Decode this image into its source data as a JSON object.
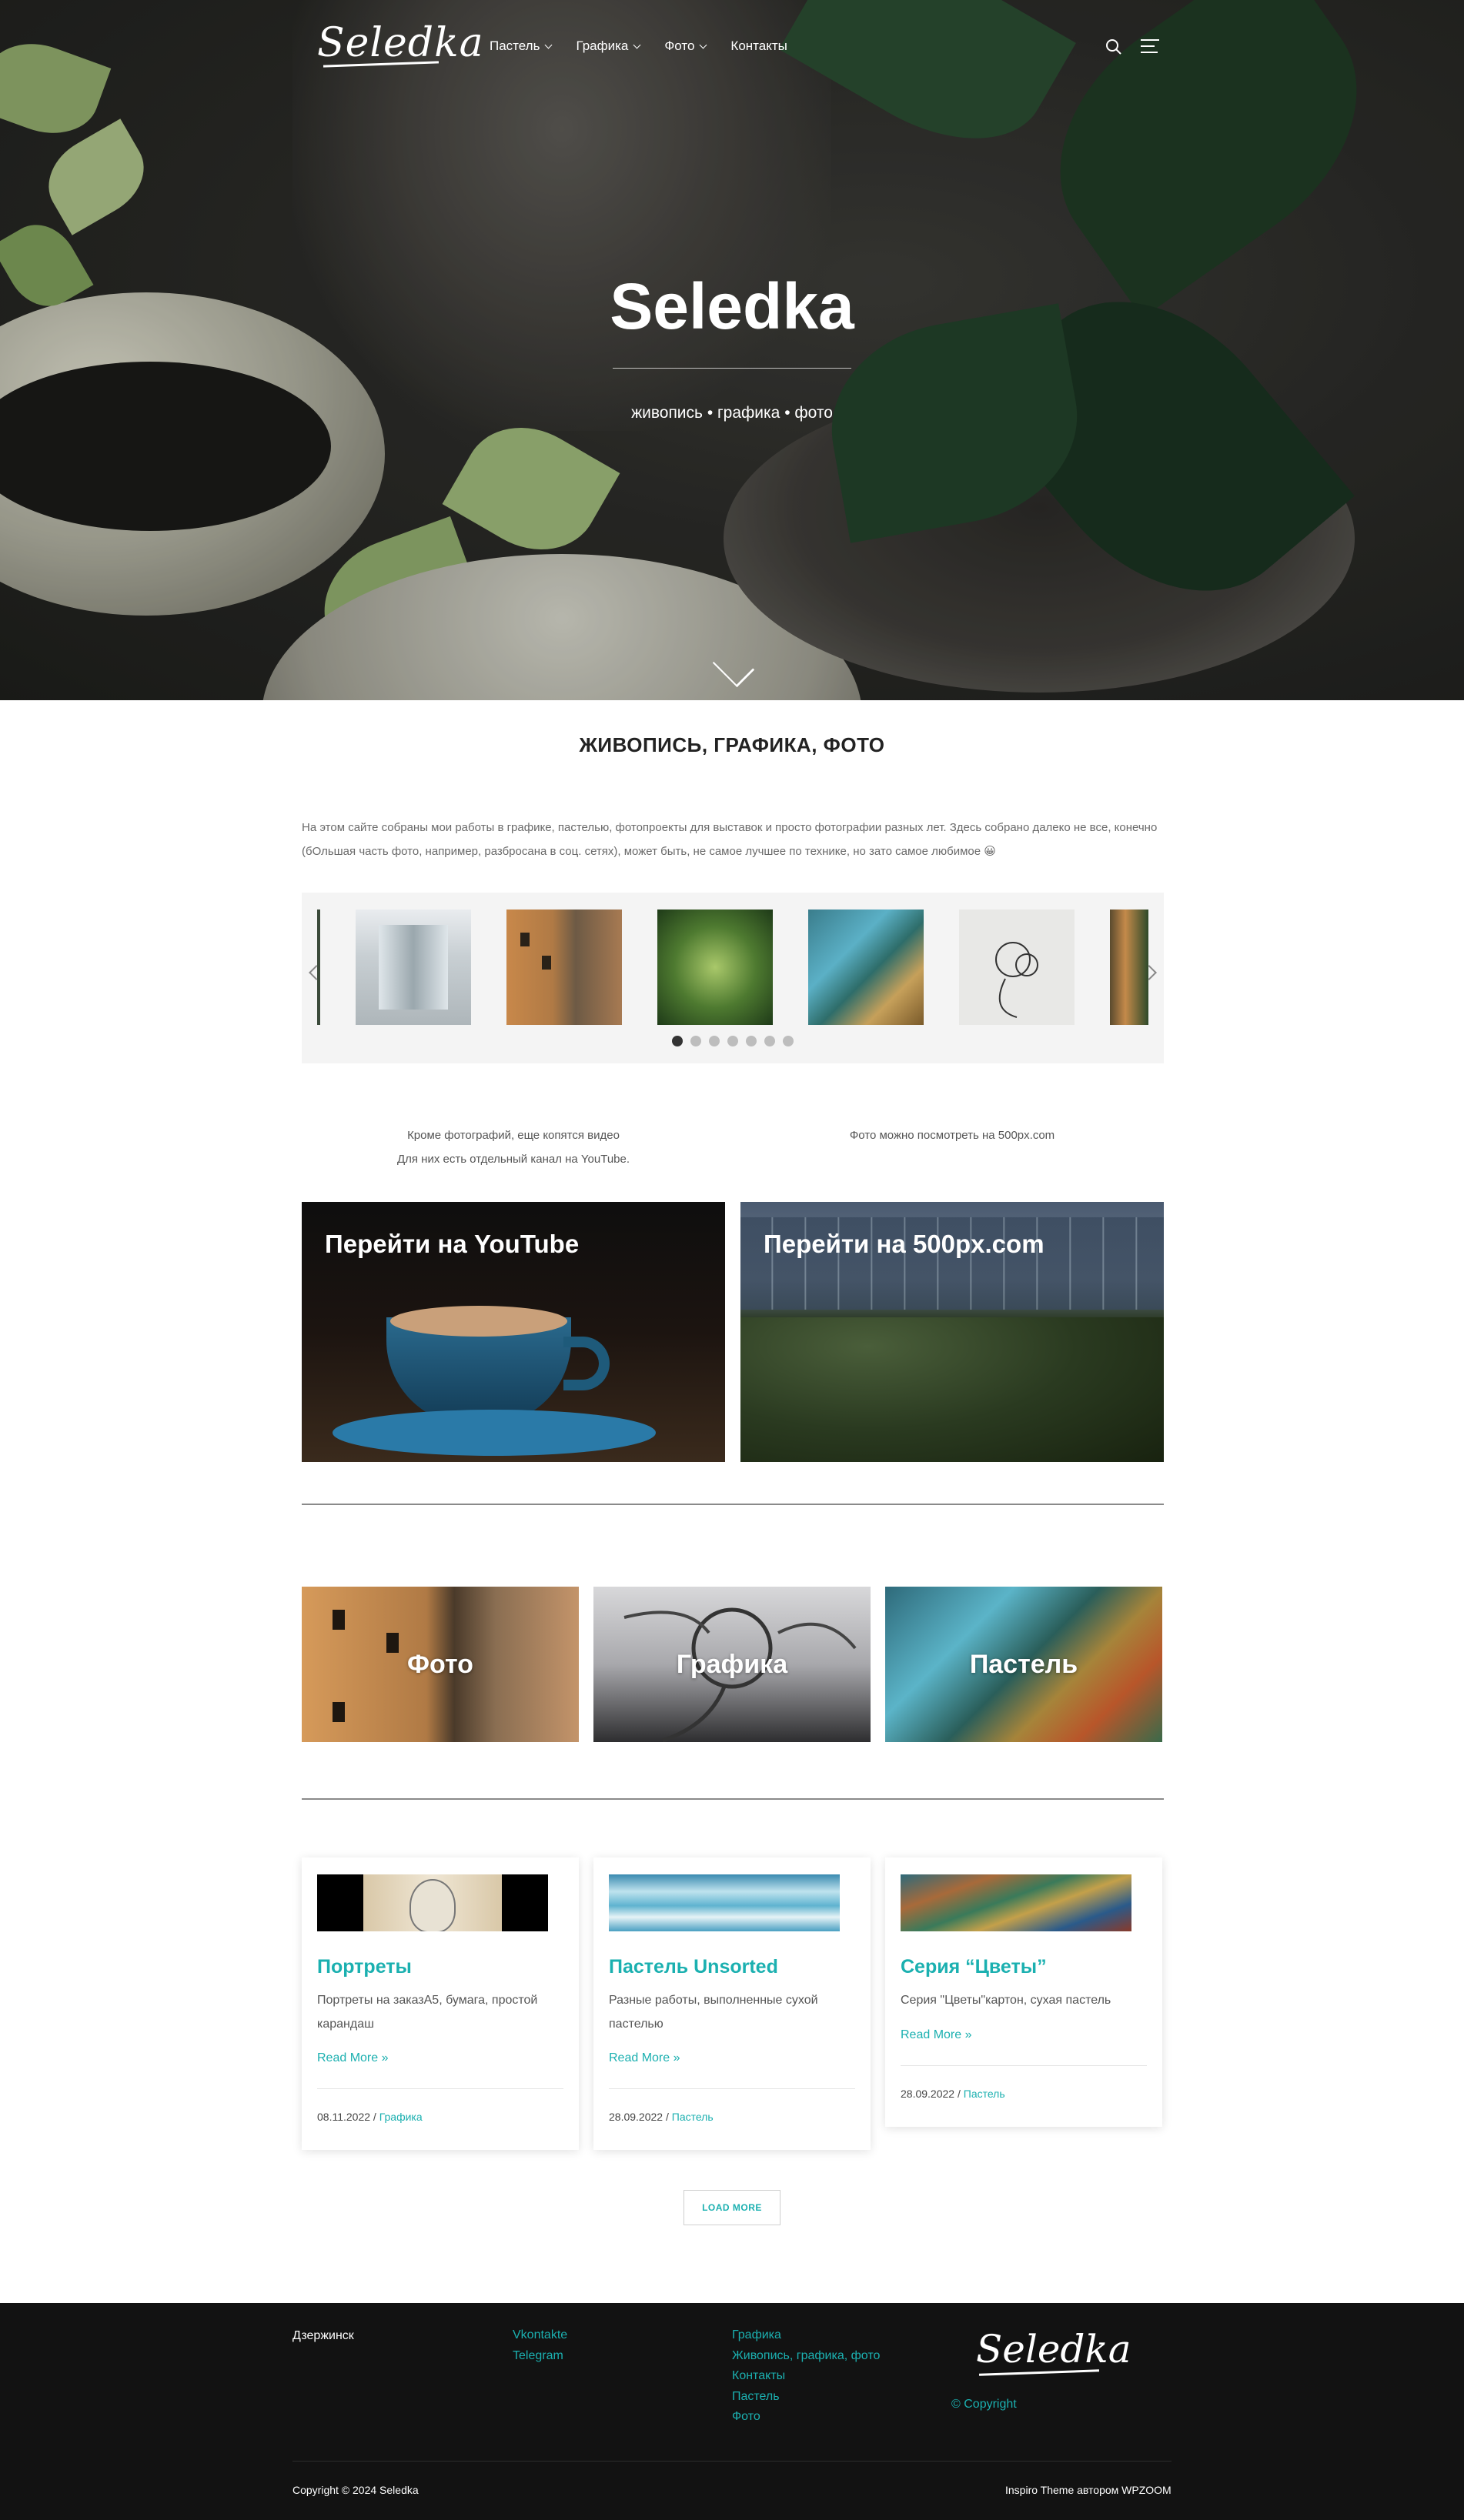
{
  "header": {
    "logo": "Seledka",
    "nav": [
      {
        "label": "Пастель",
        "has_dropdown": true
      },
      {
        "label": "Графика",
        "has_dropdown": true
      },
      {
        "label": "Фото",
        "has_dropdown": true
      },
      {
        "label": "Контакты",
        "has_dropdown": false
      }
    ],
    "search_icon": "search-icon",
    "menu_icon": "hamburger-icon"
  },
  "hero": {
    "title": "Seledka",
    "subtitle": "живопись • графика • фото",
    "scroll_icon": "chevron-down-icon"
  },
  "intro": {
    "title": "ЖИВОПИСЬ, ГРАФИКА, ФОТО",
    "text": "На этом сайте собраны мои работы в графике, пастелью, фотопроекты для выставок и просто фотографии разных лет. Здесь собрано далеко не все, конечно (бОльшая часть фото, например, разбросана в соц. сетях), может быть, не самое лучшее по технике, но зато самое любимое 😀"
  },
  "carousel": {
    "slide_count": 7,
    "active_dot": 0
  },
  "columns": {
    "left_line1": "Кроме фотографий, еще копятся видео",
    "left_line2": "Для них есть отдельный канал на YouTube.",
    "right_line1": "Фото можно посмотреть на 500px.com"
  },
  "cta": {
    "youtube": "Перейти на YouTube",
    "px500": "Перейти на 500px.com"
  },
  "categories": [
    {
      "label": "Фото"
    },
    {
      "label": "Графика"
    },
    {
      "label": "Пастель"
    }
  ],
  "posts": [
    {
      "title": "Портреты",
      "excerpt": "Портреты на заказA5, бумага, простой карандаш",
      "more": "Read More »",
      "date": "08.11.2022 / ",
      "category": "Графика"
    },
    {
      "title": "Пастель Unsorted",
      "excerpt": "Разные работы, выполненные сухой пастелью",
      "more": "Read More »",
      "date": "28.09.2022 / ",
      "category": "Пастель"
    },
    {
      "title": "Серия “Цветы”",
      "excerpt": "Серия \"Цветы\"картон, сухая пастель",
      "more": "Read More »",
      "date": "28.09.2022 / ",
      "category": "Пастель"
    }
  ],
  "load_more": "LOAD MORE",
  "footer": {
    "city": "Дзержинск",
    "social": [
      "Vkontakte",
      "Telegram"
    ],
    "links": [
      "Графика",
      "Живопись, графика, фото",
      "Контакты",
      "Пастель",
      "Фото"
    ],
    "logo": "Seledka",
    "copyright_link": "© Copyright",
    "copyright": "Copyright © 2024 Seledka",
    "credit": "Inspiro Theme автором WPZOOM"
  }
}
